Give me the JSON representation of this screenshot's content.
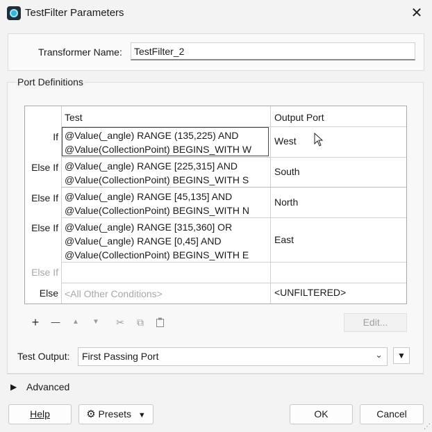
{
  "window": {
    "title": "TestFilter Parameters",
    "close": "✕"
  },
  "transformer": {
    "label": "Transformer Name:",
    "value": "TestFilter_2"
  },
  "port_definitions": {
    "legend": "Port Definitions",
    "columns": [
      "Test",
      "Output Port"
    ],
    "rows": [
      {
        "label": "If",
        "test": [
          "@Value(_angle) RANGE (135,225) AND",
          "@Value(CollectionPoint) BEGINS_WITH W"
        ],
        "port": "West"
      },
      {
        "label": "Else If",
        "test": [
          "@Value(_angle) RANGE [225,315] AND",
          "@Value(CollectionPoint) BEGINS_WITH S"
        ],
        "port": "South"
      },
      {
        "label": "Else If",
        "test": [
          "@Value(_angle) RANGE [45,135] AND",
          "@Value(CollectionPoint) BEGINS_WITH N"
        ],
        "port": "North"
      },
      {
        "label": "Else If",
        "test": [
          "@Value(_angle) RANGE [315,360] OR",
          "@Value(_angle) RANGE [0,45] AND",
          "@Value(CollectionPoint) BEGINS_WITH E"
        ],
        "port": "East"
      },
      {
        "label": "Else If",
        "test": [
          ""
        ],
        "port": ""
      },
      {
        "label": "Else",
        "test": [
          "<All Other Conditions>"
        ],
        "port": "<UNFILTERED>"
      }
    ]
  },
  "toolbar": {
    "add": "+",
    "remove": "—",
    "up": "▲",
    "down": "▼",
    "cut": "✂",
    "copy": "⧉",
    "paste": "📋",
    "edit": "Edit..."
  },
  "test_output": {
    "label": "Test Output:",
    "value": "First Passing Port",
    "chevron": "⌄"
  },
  "advanced": {
    "label": "Advanced"
  },
  "buttons": {
    "help": "Help",
    "presets": "Presets",
    "ok": "OK",
    "cancel": "Cancel"
  },
  "icons": {
    "gear": "⚙",
    "dropdown": "▼",
    "triangle_right": "▶",
    "cursor": "mouse-pointer"
  }
}
